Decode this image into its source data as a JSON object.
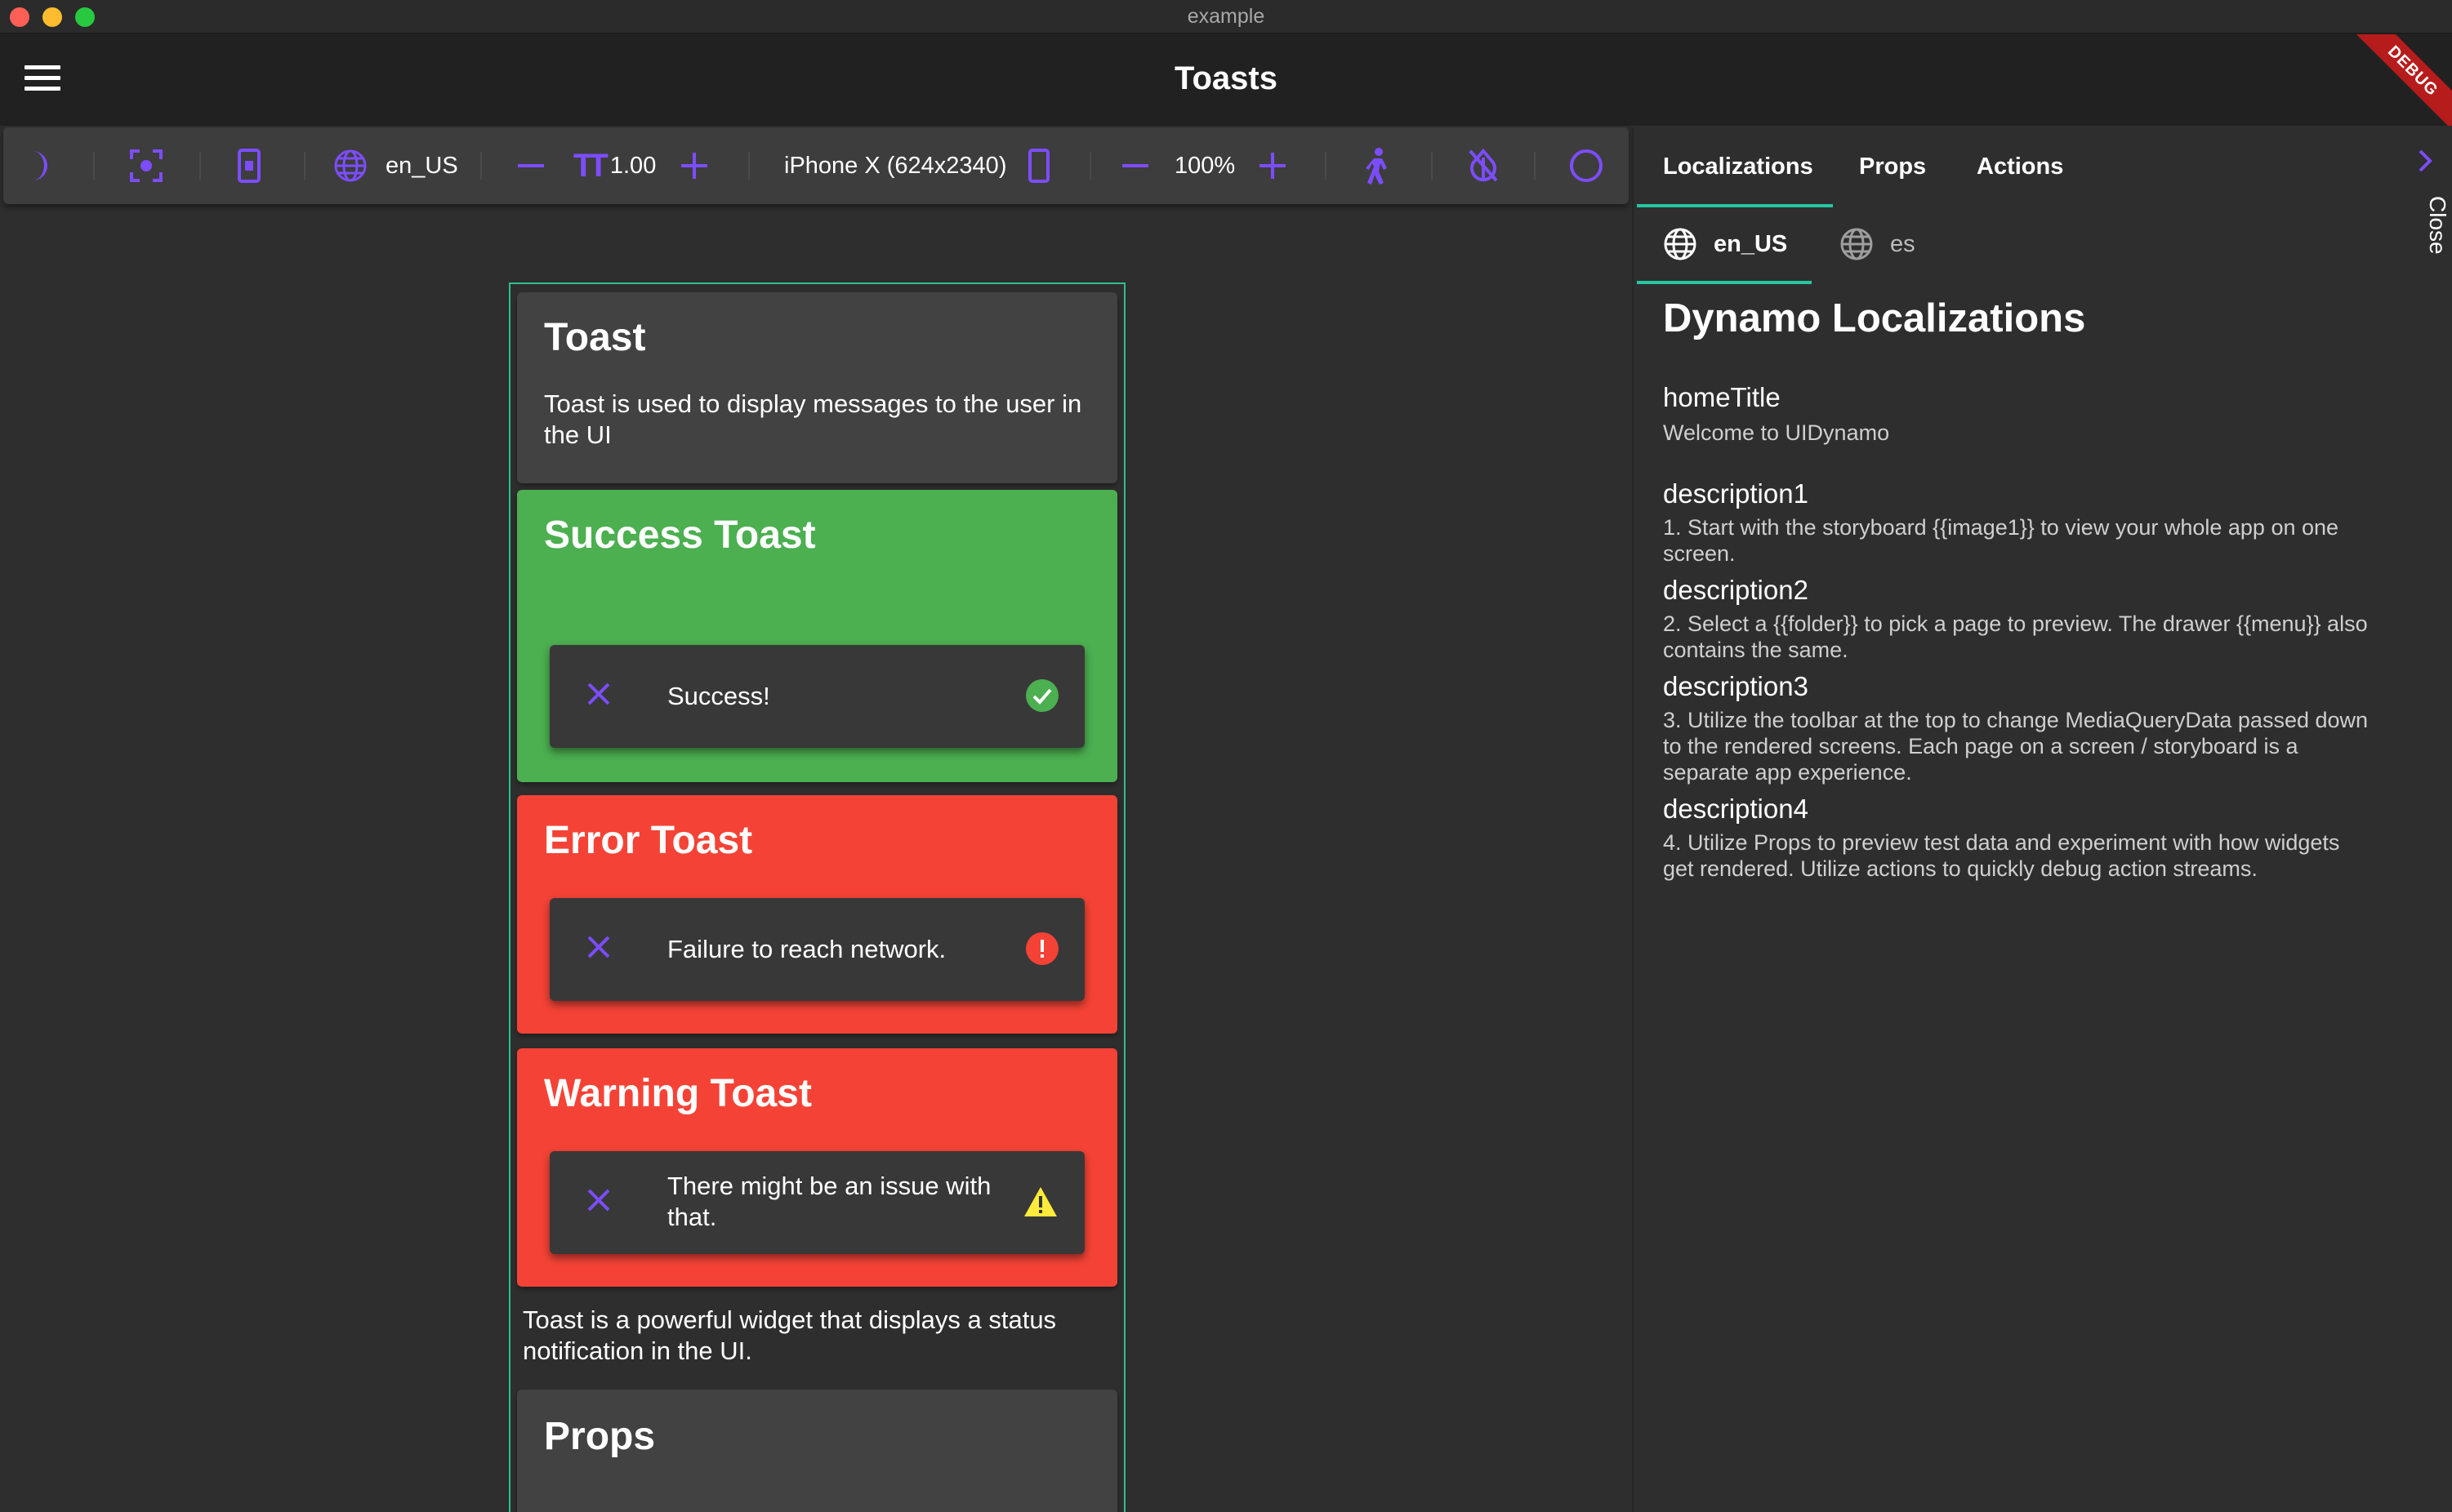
{
  "window": {
    "title": "example"
  },
  "appbar": {
    "title": "Toasts",
    "debug_label": "DEBUG"
  },
  "toolbar": {
    "locale": "en_US",
    "text_scale": "1.00",
    "device": "iPhone X (624x2340)",
    "zoom": "100%",
    "icons": [
      "dark-mode-icon",
      "screenshot-icon",
      "device-frame-icon",
      "language-icon",
      "decrease-text-icon",
      "text-size-icon",
      "increase-text-icon",
      "phone-orientation-icon",
      "zoom-out-icon",
      "zoom-in-icon",
      "accessibility-icon",
      "invert-colors-off-icon",
      "circle-icon"
    ]
  },
  "preview": {
    "intro_card": {
      "title": "Toast",
      "description": "Toast is used to display messages to the user in the UI"
    },
    "success": {
      "title": "Success Toast",
      "message": "Success!",
      "color": "#4caf50",
      "status_icon": "check-circle-icon"
    },
    "error": {
      "title": "Error Toast",
      "message": "Failure to reach network.",
      "color": "#f44336",
      "status_icon": "error-icon"
    },
    "warning": {
      "title": "Warning Toast",
      "message": "There might be an issue with that.",
      "color": "#f44336",
      "status_icon": "warning-icon"
    },
    "footer_text": "Toast is a powerful widget that displays a status notification in the UI.",
    "props_card": {
      "title": "Props"
    }
  },
  "panel": {
    "tabs": [
      {
        "label": "Localizations",
        "active": true
      },
      {
        "label": "Props",
        "active": false
      },
      {
        "label": "Actions",
        "active": false
      }
    ],
    "locale_tabs": [
      {
        "label": "en_US",
        "active": true
      },
      {
        "label": "es",
        "active": false
      }
    ],
    "section_title": "Dynamo Localizations",
    "entries": [
      {
        "key": "homeTitle",
        "value": "Welcome to UIDynamo"
      },
      {
        "key": "description1",
        "value": "1. Start with the storyboard {{image1}} to view your whole app on one screen."
      },
      {
        "key": "description2",
        "value": "2. Select a {{folder}} to pick a page to preview. The drawer {{menu}} also contains the same."
      },
      {
        "key": "description3",
        "value": "3. Utilize the toolbar at the top to change MediaQueryData passed down to the rendered screens. Each page on a screen / storyboard is a separate app experience."
      },
      {
        "key": "description4",
        "value": "4. Utilize Props to preview test data and experiment with how widgets get rendered. Utilize actions to quickly debug action streams."
      }
    ],
    "close_label": "Close"
  },
  "colors": {
    "accent": "#7c4dff",
    "tab_indicator": "#26c6a0",
    "preview_border": "#2fbf8f"
  }
}
